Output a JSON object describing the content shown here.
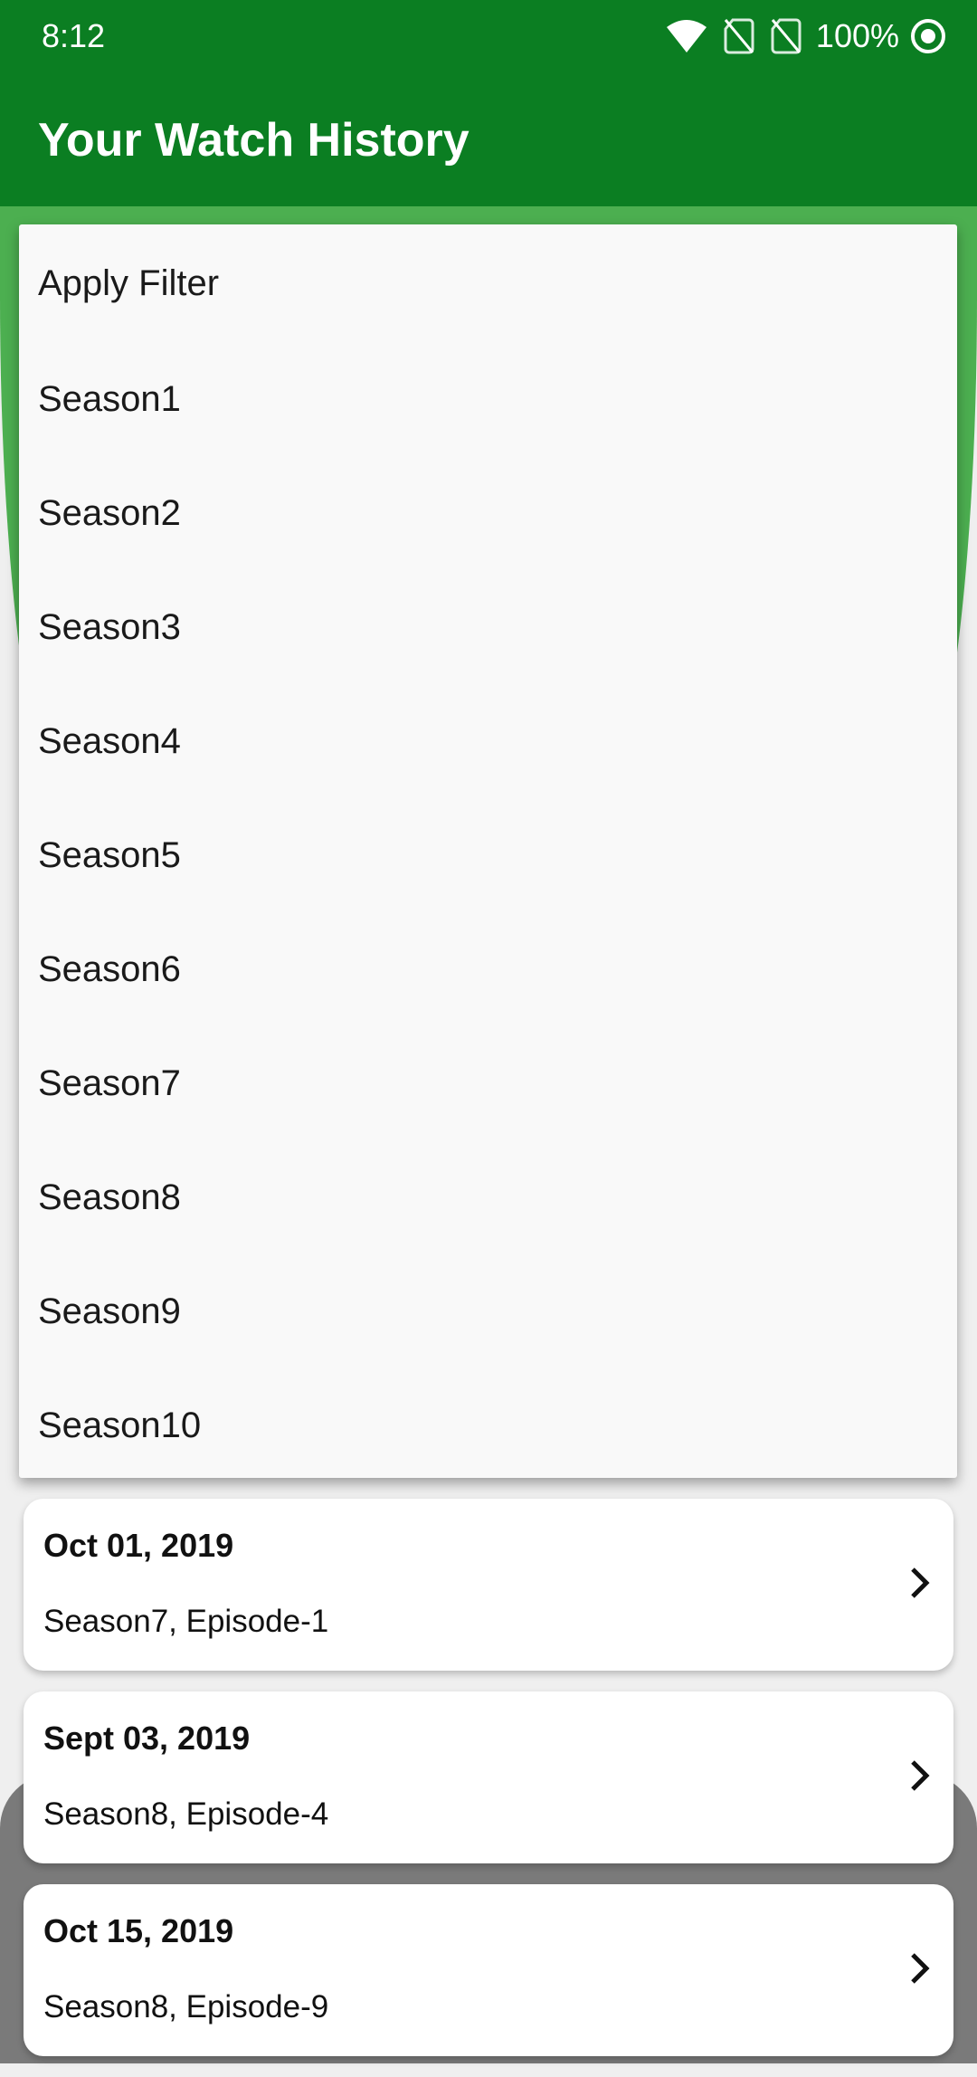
{
  "status_bar": {
    "time": "8:12",
    "battery": "100%",
    "icons": [
      "wifi-icon",
      "no-sim-icon",
      "no-sim-icon",
      "target-icon"
    ]
  },
  "app_bar": {
    "title": "Your Watch History"
  },
  "filter_menu": {
    "items": [
      {
        "label": "Apply Filter"
      },
      {
        "label": "Season1"
      },
      {
        "label": "Season2"
      },
      {
        "label": "Season3"
      },
      {
        "label": "Season4"
      },
      {
        "label": "Season5"
      },
      {
        "label": "Season6"
      },
      {
        "label": "Season7"
      },
      {
        "label": "Season8"
      },
      {
        "label": "Season9"
      },
      {
        "label": "Season10"
      }
    ]
  },
  "history": [
    {
      "date": "Oct 01, 2019",
      "episode": "Season7, Episode-1",
      "icon": "chevron-right-icon"
    },
    {
      "date": "Sept 03, 2019",
      "episode": "Season8, Episode-4",
      "icon": "chevron-right-icon"
    },
    {
      "date": "Oct 15, 2019",
      "episode": "Season8, Episode-9",
      "icon": "chevron-right-icon"
    }
  ],
  "colors": {
    "app_bar": "#0b7e22",
    "accent_green": "#4caf50",
    "menu_background": "#f9f9f9",
    "bottom_background": "#7a7a7a"
  }
}
